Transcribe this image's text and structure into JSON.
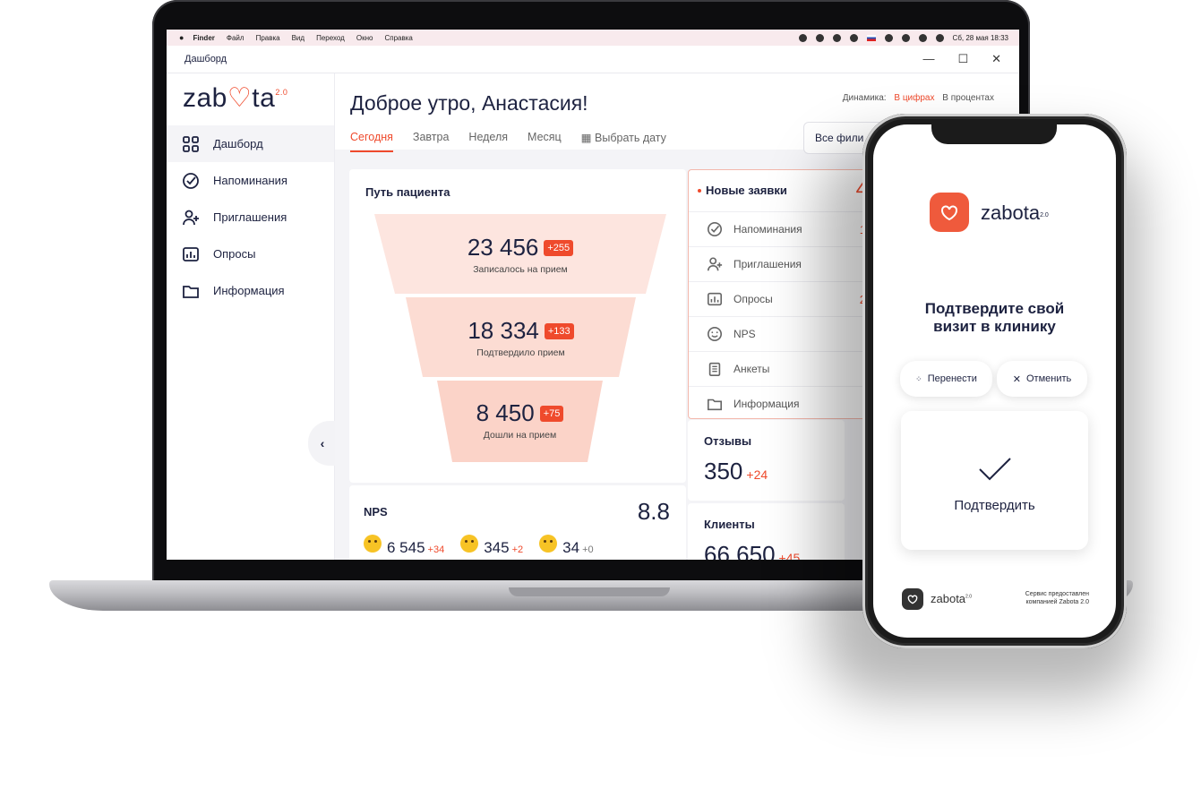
{
  "menubar": {
    "app": "Finder",
    "items": [
      "Файл",
      "Правка",
      "Вид",
      "Переход",
      "Окно",
      "Справка"
    ],
    "datetime": "Сб, 28 мая  18:33"
  },
  "window": {
    "title": "Дашборд"
  },
  "brand": {
    "logo_text_a": "zab",
    "logo_text_b": "ta",
    "version": "2.0"
  },
  "sidebar": {
    "items": [
      {
        "label": "Дашборд",
        "icon": "grid-icon",
        "active": true
      },
      {
        "label": "Напоминания",
        "icon": "check-circle-icon"
      },
      {
        "label": "Приглашения",
        "icon": "user-plus-icon"
      },
      {
        "label": "Опросы",
        "icon": "chart-icon"
      },
      {
        "label": "Информация",
        "icon": "folder-icon"
      }
    ]
  },
  "header": {
    "greeting": "Доброе утро, Анастасия!",
    "dynamics_label": "Динамика:",
    "dynamics_on": "В цифрах",
    "dynamics_off": "В процентах",
    "tabs": [
      "Сегодня",
      "Завтра",
      "Неделя",
      "Месяц"
    ],
    "date_picker": "Выбрать дату",
    "filter": "Все фили"
  },
  "funnel": {
    "title": "Путь пациента",
    "stages": [
      {
        "value": "23 456",
        "delta": "+255",
        "caption": "Записалось на прием"
      },
      {
        "value": "18 334",
        "delta": "+133",
        "caption": "Подтвердило прием"
      },
      {
        "value": "8 450",
        "delta": "+75",
        "caption": "Дошли на прием"
      }
    ]
  },
  "nps": {
    "label": "NPS",
    "value": "8.8",
    "groups": [
      {
        "value": "6 545",
        "delta": "+34"
      },
      {
        "value": "345",
        "delta": "+2"
      },
      {
        "value": "34",
        "delta": "+0"
      }
    ]
  },
  "requests": {
    "title": "Новые заявки",
    "count_partial": "4",
    "items": [
      {
        "label": "Напоминания",
        "icon": "check-circle-icon",
        "count_partial": "1"
      },
      {
        "label": "Приглашения",
        "icon": "user-plus-icon",
        "count_partial": ""
      },
      {
        "label": "Опросы",
        "icon": "chart-icon",
        "count_partial": "2"
      },
      {
        "label": "NPS",
        "icon": "smile-icon",
        "count_partial": ""
      },
      {
        "label": "Анкеты",
        "icon": "clipboard-icon",
        "count_partial": ""
      },
      {
        "label": "Информация",
        "icon": "folder-icon",
        "count_partial": ""
      }
    ]
  },
  "reviews": {
    "label": "Отзывы",
    "value": "350",
    "delta": "+24"
  },
  "clients": {
    "label": "Клиенты",
    "value": "66 650",
    "delta": "+45"
  },
  "phone": {
    "brand": "zabota",
    "version": "2.0",
    "title_line1": "Подтвердите свой",
    "title_line2": "визит в клинику",
    "reschedule": "Перенести",
    "cancel": "Отменить",
    "confirm": "Подтвердить",
    "footer_brand": "zabota",
    "footer_note": "Сервис предоставлен компанией Zabota 2.0"
  },
  "colors": {
    "accent": "#ef4a2c",
    "navy": "#1d2240"
  }
}
